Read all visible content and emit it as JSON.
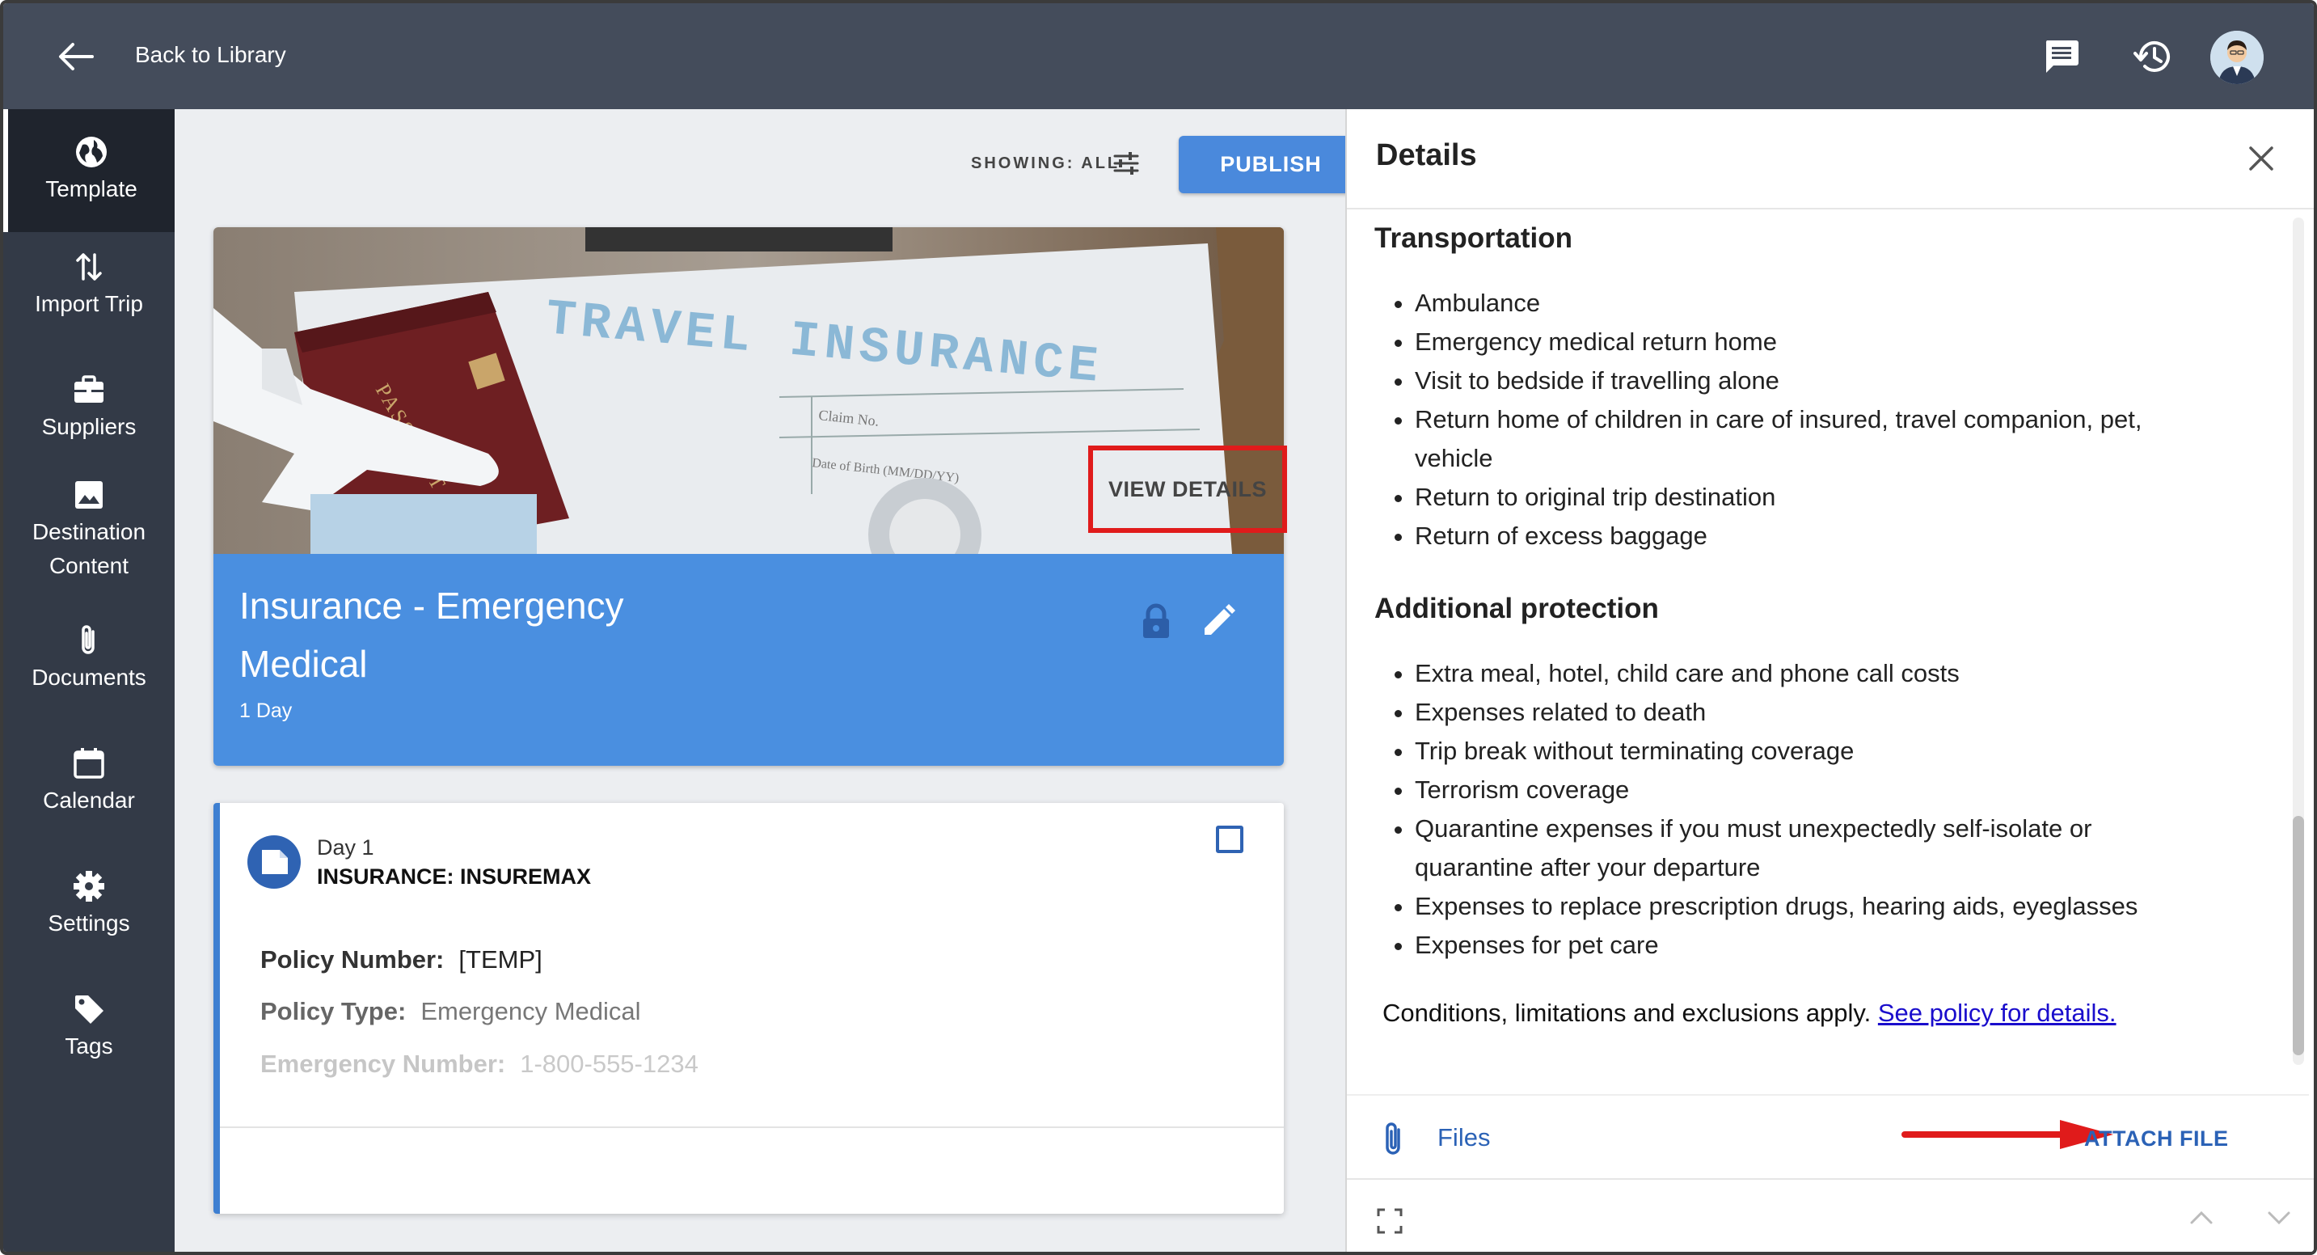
{
  "topbar": {
    "back_label": "Back to Library",
    "icons": [
      "chat-icon",
      "history-icon",
      "avatar"
    ]
  },
  "sidebar": {
    "items": [
      {
        "label": "Template",
        "icon": "globe-icon",
        "active": true
      },
      {
        "label": "Import Trip",
        "icon": "import-arrows-icon"
      },
      {
        "label": "Suppliers",
        "icon": "briefcase-icon"
      },
      {
        "label": "Destination Content",
        "icon": "image-icon"
      },
      {
        "label": "Documents",
        "icon": "paperclip-icon"
      },
      {
        "label": "Calendar",
        "icon": "calendar-icon"
      },
      {
        "label": "Settings",
        "icon": "gear-icon"
      },
      {
        "label": "Tags",
        "icon": "tag-icon"
      }
    ]
  },
  "main": {
    "showing_label": "SHOWING: ALL",
    "publish_label": "PUBLISH",
    "hero": {
      "image_text_1": "TRAVEL INSURANCE",
      "image_text_2": "PASSPORT",
      "image_text_3": "Claim No.",
      "image_text_4": "Date of Birth (MM/DD/YY)",
      "title": "Insurance - Emergency Medical",
      "subtitle": "1 Day"
    },
    "day_card": {
      "day_label": "Day 1",
      "type_label": "INSURANCE: INSUREMAX",
      "fields": [
        {
          "label": "Policy Number:",
          "value": "[TEMP]"
        },
        {
          "label": "Policy Type:",
          "value": "Emergency Medical"
        },
        {
          "label": "Emergency Number:",
          "value": "1-800-555-1234"
        }
      ],
      "view_details_label": "VIEW DETAILS"
    }
  },
  "details": {
    "title": "Details",
    "sections": [
      {
        "heading": "Transportation",
        "items": [
          "Ambulance",
          "Emergency medical return home",
          "Visit to bedside if travelling alone",
          "Return home of children in care of insured, travel companion, pet, vehicle",
          "Return to original trip destination",
          "Return of excess baggage"
        ]
      },
      {
        "heading": "Additional protection",
        "items": [
          "Extra meal, hotel, child care and phone call costs",
          "Expenses related to death",
          "Trip break without terminating coverage",
          "Terrorism coverage",
          "Quarantine expenses if you must unexpectedly self-isolate or quarantine after your departure",
          "Expenses to replace prescription drugs, hearing aids, eyeglasses",
          "Expenses for pet care"
        ]
      }
    ],
    "conditions_text": "Conditions, limitations and exclusions apply.",
    "policy_link": "See policy for details.",
    "files_label": "Files",
    "attach_label": "ATTACH FILE"
  },
  "colors": {
    "topbar": "#444c5b",
    "sidebar": "#333a47",
    "accent": "#4a89dc",
    "highlight": "#e01b1b"
  }
}
